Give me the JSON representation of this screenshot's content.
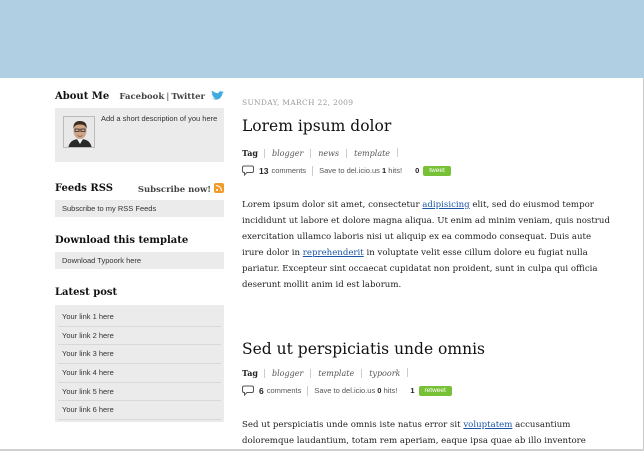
{
  "sidebar": {
    "about": {
      "title": "About Me",
      "facebook": "Facebook",
      "separator": "|",
      "twitter": "Twitter",
      "description": "Add a short description of you here"
    },
    "feeds": {
      "title": "Feeds RSS",
      "subscribe_now": "Subscribe now!",
      "subscribe_link": "Subscribe to my RSS Feeds"
    },
    "download": {
      "title": "Download this template",
      "link": "Download Typoork here"
    },
    "latest": {
      "title": "Latest post",
      "items": [
        "Your link 1 here",
        "Your link 2 here",
        "Your link 3 here",
        "Your link 4 here",
        "Your link 5 here",
        "Your link 6 here"
      ]
    }
  },
  "posts": [
    {
      "date": "SUNDAY, MARCH 22, 2009",
      "title": "Lorem ipsum dolor",
      "tag_label": "Tag",
      "tags": [
        "blogger",
        "news",
        "template"
      ],
      "comments_count": "13",
      "comments_label": "comments",
      "delicious_prefix": "Save to del.icio.us",
      "hits_count": "1",
      "hits_label": "hits!",
      "tweet_count": "0",
      "tweet_label": "tweet",
      "body": {
        "p1": "Lorem ipsum dolor sit amet, consectetur ",
        "link1": "adipisicing",
        "p2": " elit, sed do eiusmod tempor incididunt ut labore et dolore magna aliqua. Ut enim ad minim veniam, quis nostrud exercitation ullamco laboris nisi ut aliquip ex ea commodo consequat. Duis aute irure dolor in ",
        "link2": "reprehenderit",
        "p3": " in voluptate velit esse cillum dolore eu fugiat nulla pariatur. Excepteur sint occaecat cupidatat non proident, sunt in culpa qui officia deserunt mollit anim id est laborum."
      }
    },
    {
      "title": "Sed ut perspiciatis unde omnis",
      "tag_label": "Tag",
      "tags": [
        "blogger",
        "template",
        "typoork"
      ],
      "comments_count": "6",
      "comments_label": "comments",
      "delicious_prefix": "Save to del.icio.us",
      "hits_count": "0",
      "hits_label": "hits!",
      "tweet_count": "1",
      "tweet_label": "retweet",
      "body": {
        "p1": "Sed ut perspiciatis unde omnis iste natus error sit ",
        "link1": "voluptatem",
        "p2": " accusantium doloremque laudantium, totam rem aperiam, eaque ipsa quae ab illo inventore"
      }
    }
  ],
  "colors": {
    "header": "#b0cfe2",
    "sidebar_box": "#ebebeb",
    "tweet_button": "#77c137",
    "link": "#1a55a6",
    "rss": "#f39a2b",
    "twitter_bird": "#3fa9e0"
  },
  "icons": {
    "twitter": "twitter-bird-icon",
    "rss": "rss-icon",
    "comment": "comment-bubble-icon"
  }
}
